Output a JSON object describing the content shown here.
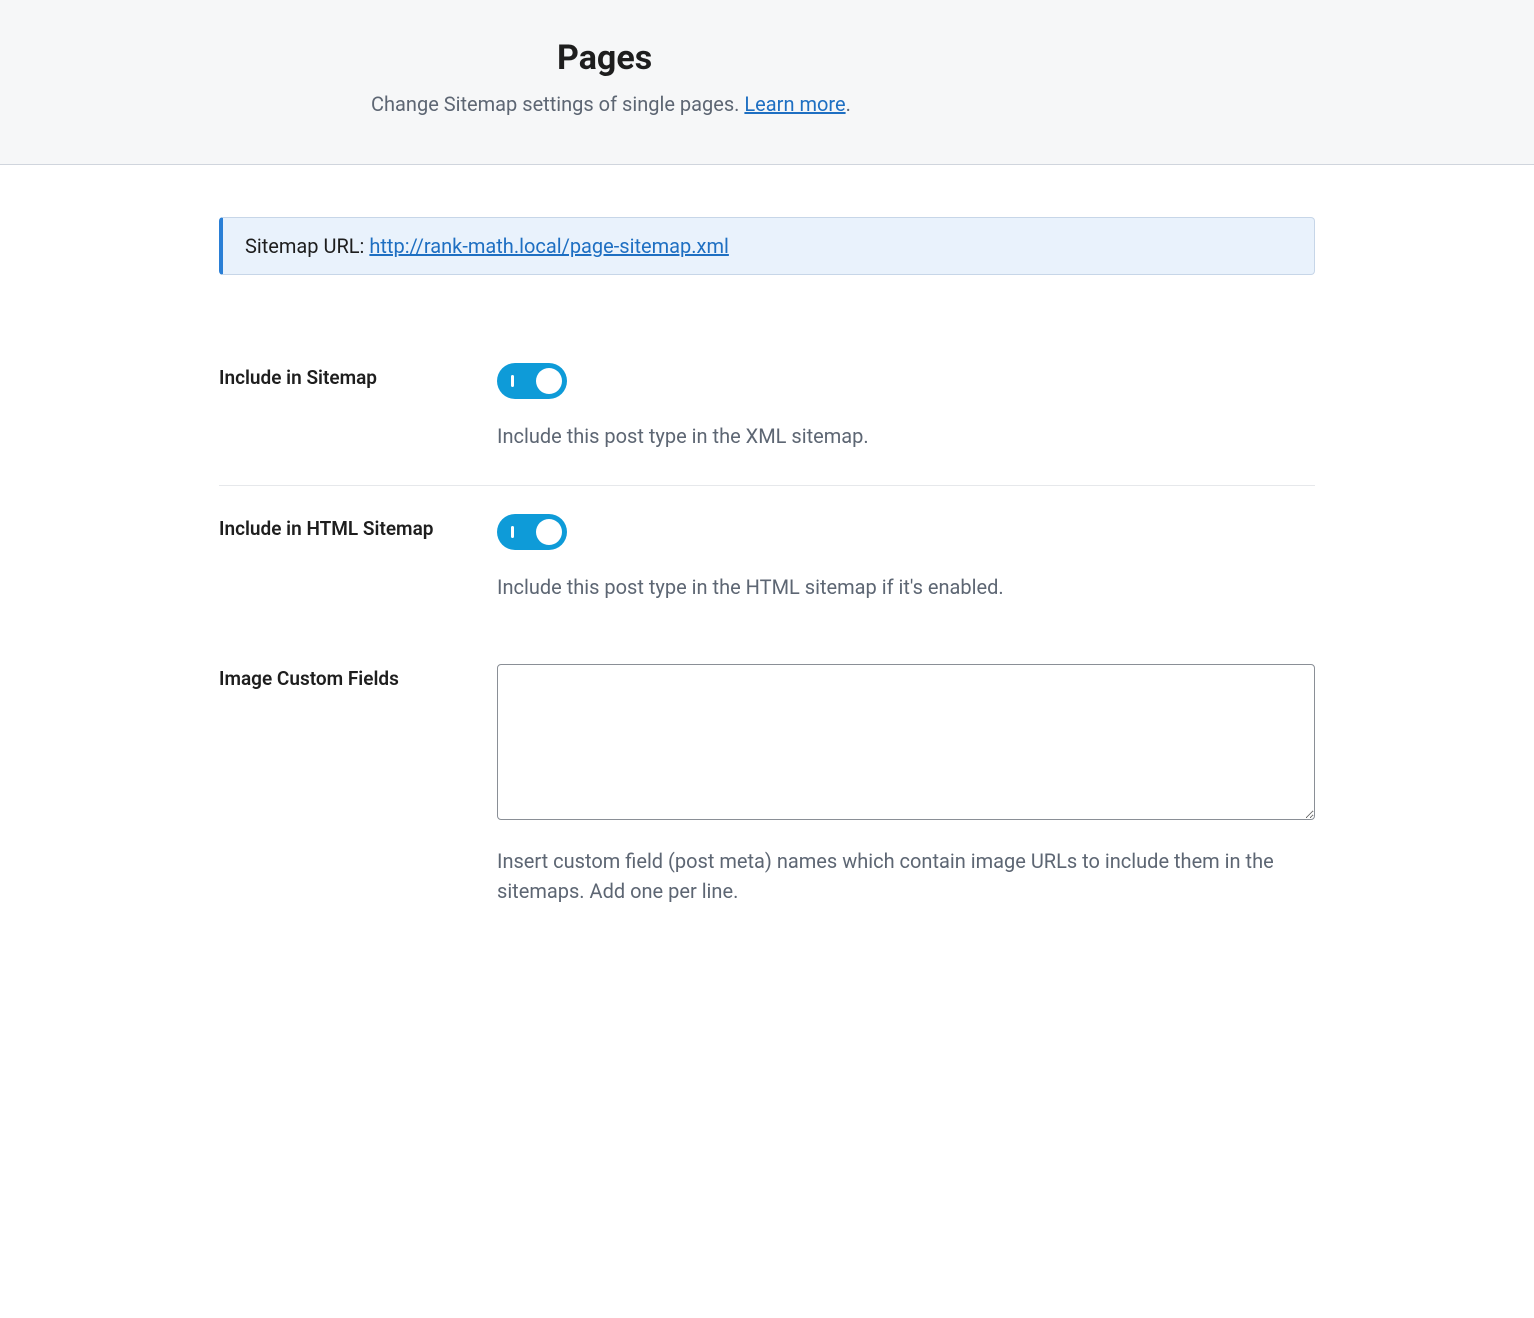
{
  "header": {
    "title": "Pages",
    "subtitle_prefix": "Change Sitemap settings of single pages. ",
    "learn_more_label": "Learn more",
    "subtitle_suffix": "."
  },
  "notice": {
    "label": "Sitemap URL: ",
    "link_text": "http://rank-math.local/page-sitemap.xml"
  },
  "settings": {
    "include_sitemap": {
      "label": "Include in Sitemap",
      "description": "Include this post type in the XML sitemap.",
      "enabled": true
    },
    "include_html_sitemap": {
      "label": "Include in HTML Sitemap",
      "description": "Include this post type in the HTML sitemap if it's enabled.",
      "enabled": true
    },
    "image_custom_fields": {
      "label": "Image Custom Fields",
      "value": "",
      "description": "Insert custom field (post meta) names which contain image URLs to include them in the sitemaps. Add one per line."
    }
  }
}
